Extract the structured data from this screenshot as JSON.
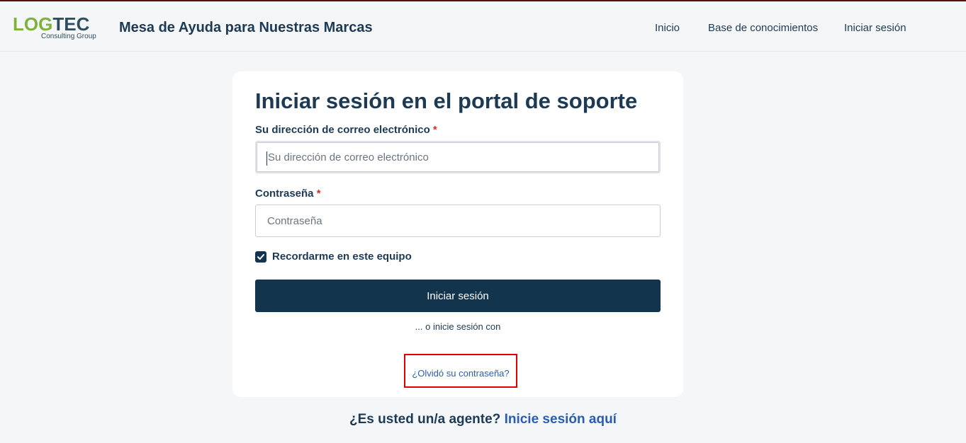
{
  "header": {
    "logo": {
      "brand_part1": "LOG",
      "brand_part2": "TEC",
      "tagline": "Consulting Group"
    },
    "title": "Mesa de Ayuda para Nuestras Marcas",
    "nav": [
      {
        "label": "Inicio"
      },
      {
        "label": "Base de conocimientos"
      },
      {
        "label": "Iniciar sesión"
      }
    ]
  },
  "login": {
    "title": "Iniciar sesión en el portal de soporte",
    "email": {
      "label": "Su dirección de correo electrónico",
      "required_mark": "*",
      "placeholder": "Su dirección de correo electrónico",
      "value": ""
    },
    "password": {
      "label": "Contraseña",
      "required_mark": "*",
      "placeholder": "Contraseña",
      "value": ""
    },
    "remember": {
      "label": "Recordarme en este equipo",
      "checked": true
    },
    "submit_label": "Iniciar sesión",
    "alt_login_text": "... o inicie sesión con",
    "forgot_password_link": "¿Olvidó su contraseña?"
  },
  "agent": {
    "question": "¿Es usted un/a agente?",
    "link": "Inicie sesión aquí"
  },
  "colors": {
    "primary": "#12344d",
    "link": "#2a5db0",
    "highlight_box": "#e00000",
    "logo_green": "#7fb239"
  }
}
